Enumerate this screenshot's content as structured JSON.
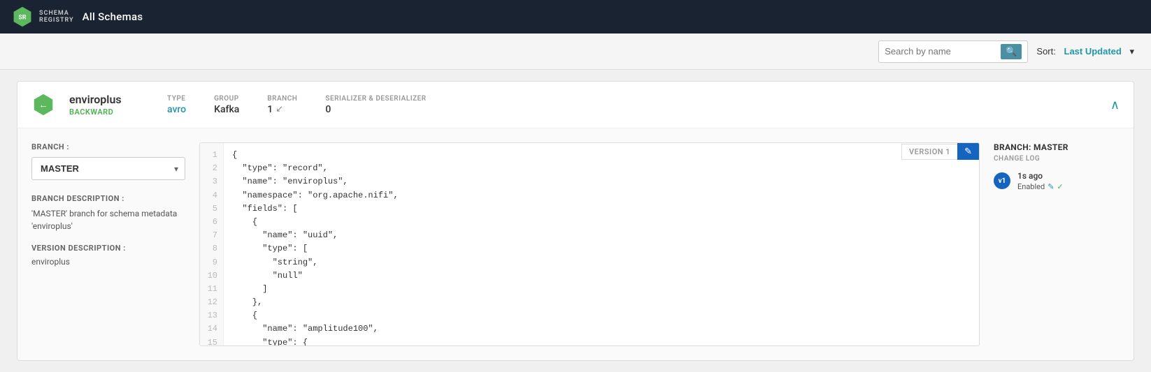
{
  "topbar": {
    "logo_text": "SCHEMA\nREGISTRY",
    "title": "All Schemas"
  },
  "toolbar": {
    "search_placeholder": "Search by name",
    "search_icon": "🔍",
    "sort_label": "Sort:",
    "sort_value": "Last Updated",
    "sort_arrow": "▾"
  },
  "schema": {
    "name": "enviroplus",
    "compat": "BACKWARD",
    "back_label": "←",
    "type_label": "TYPE",
    "type_value": "avro",
    "group_label": "GROUP",
    "group_value": "Kafka",
    "branch_label": "BRANCH",
    "branch_value": "1",
    "branch_icon": "↙",
    "serializer_label": "SERIALIZER & DESERIALIZER",
    "serializer_value": "0",
    "collapse_icon": "∧",
    "left": {
      "branch_field_label": "BRANCH :",
      "branch_select_value": "MASTER",
      "branch_desc_label": "BRANCH DESCRIPTION :",
      "branch_desc_text": "'MASTER' branch for schema metadata 'enviroplus'",
      "version_desc_label": "VERSION DESCRIPTION :",
      "version_desc_text": "enviroplus"
    },
    "code": {
      "version_label": "VERSION 1",
      "edit_icon": "✎",
      "lines": [
        {
          "num": 1,
          "text": "{"
        },
        {
          "num": 2,
          "text": "  \"type\": \"record\","
        },
        {
          "num": 3,
          "text": "  \"name\": \"enviroplus\","
        },
        {
          "num": 4,
          "text": "  \"namespace\": \"org.apache.nifi\","
        },
        {
          "num": 5,
          "text": "  \"fields\": ["
        },
        {
          "num": 6,
          "text": "    {"
        },
        {
          "num": 7,
          "text": "      \"name\": \"uuid\","
        },
        {
          "num": 8,
          "text": "      \"type\": ["
        },
        {
          "num": 9,
          "text": "        \"string\","
        },
        {
          "num": 10,
          "text": "        \"null\""
        },
        {
          "num": 11,
          "text": "      ]"
        },
        {
          "num": 12,
          "text": "    },"
        },
        {
          "num": 13,
          "text": "    {"
        },
        {
          "num": 14,
          "text": "      \"name\": \"amplitude100\","
        },
        {
          "num": 15,
          "text": "      \"type\": {"
        }
      ]
    },
    "right": {
      "branch_title": "BRANCH: MASTER",
      "changelog_label": "CHANGE LOG",
      "v1_badge": "v1",
      "v1_time": "1s ago",
      "v1_status": "Enabled",
      "edit_icon": "✎",
      "check_icon": "✓"
    }
  }
}
